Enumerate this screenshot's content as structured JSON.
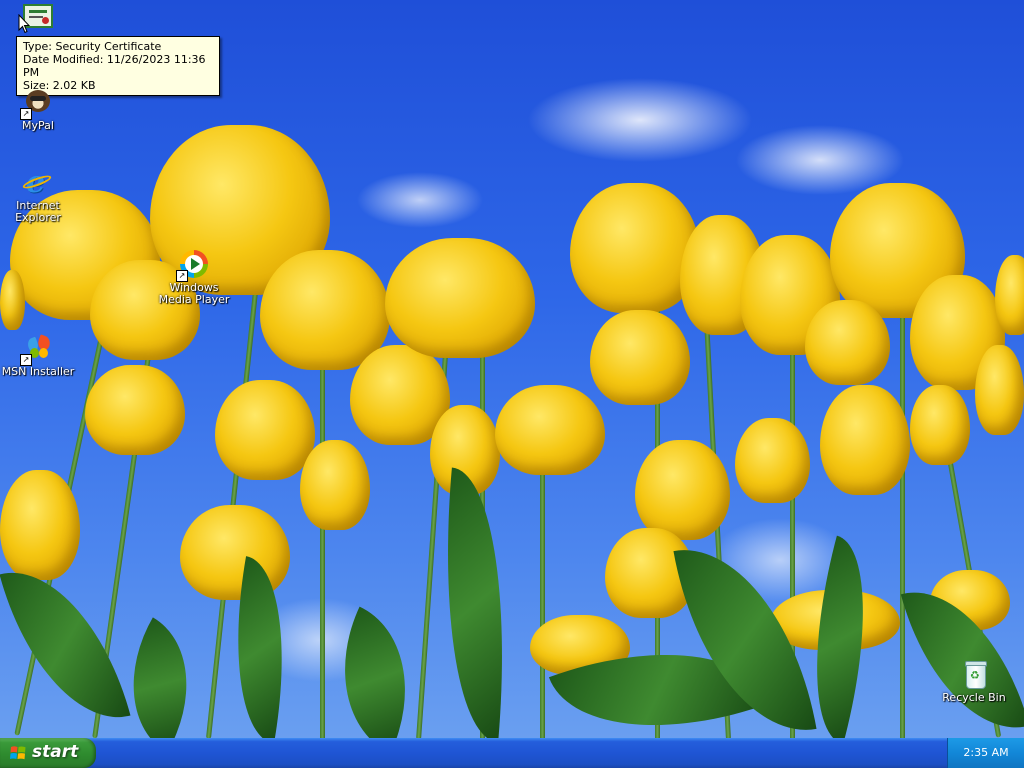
{
  "desktop": {
    "icons": [
      {
        "name": "certificate",
        "label": ""
      },
      {
        "name": "mypal",
        "label": "MyPal"
      },
      {
        "name": "internet-explorer",
        "label": "Internet Explorer"
      },
      {
        "name": "windows-media-player",
        "label": "Windows Media Player"
      },
      {
        "name": "msn-installer",
        "label": "MSN Installer"
      },
      {
        "name": "recycle-bin",
        "label": "Recycle Bin"
      }
    ],
    "tooltip": {
      "line1": "Type: Security Certificate",
      "line2": "Date Modified: 11/26/2023 11:36 PM",
      "line3": "Size: 2.02 KB"
    }
  },
  "taskbar": {
    "start_label": "start",
    "clock": "2:35 AM"
  },
  "colors": {
    "taskbar_blue": "#245edc",
    "start_green": "#3a9a3a",
    "tray_blue": "#1287d8",
    "tooltip_bg": "#ffffe1"
  }
}
